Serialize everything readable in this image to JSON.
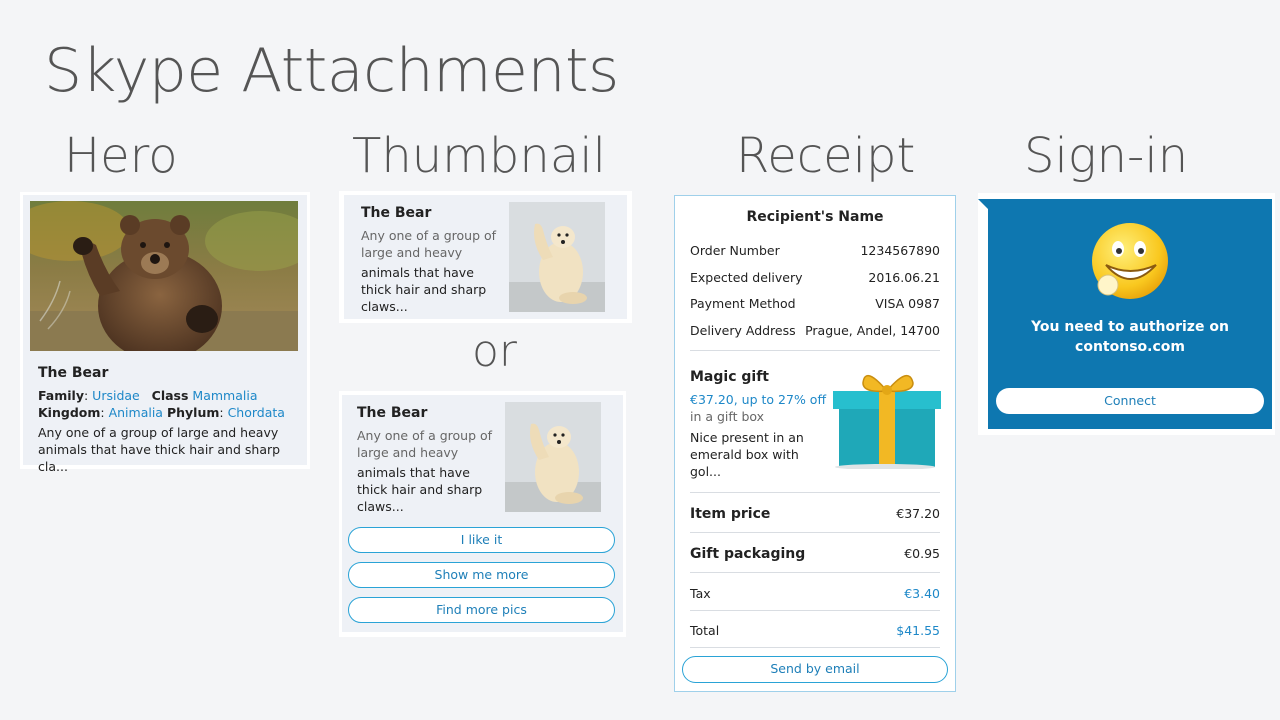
{
  "page": {
    "title": "Skype Attachments"
  },
  "sections": {
    "hero": "Hero",
    "thumbnail": "Thumbnail",
    "receipt": "Receipt",
    "signin": "Sign-in",
    "or": "or"
  },
  "hero_card": {
    "title": "The Bear",
    "family_label": "Family",
    "family_value": "Ursidae",
    "class_label": "Class",
    "class_value": "Mammalia",
    "kingdom_label": "Kingdom",
    "kingdom_value": "Animalia",
    "phylum_label": "Phylum",
    "phylum_value": "Chordata",
    "description": "Any one of a group of large and heavy animals that have thick hair and sharp cla..."
  },
  "thumbnail_card": {
    "title": "The Bear",
    "subtitle": "Any one of a group of large and heavy",
    "text": "animals that have thick hair and sharp claws..."
  },
  "thumbnail_card_buttons": {
    "title": "The Bear",
    "subtitle": "Any one of a group of large and heavy",
    "text": "animals that have thick hair and sharp claws...",
    "buttons": [
      "I  like it",
      "Show me more",
      "Find more pics"
    ]
  },
  "receipt": {
    "recipient": "Recipient's Name",
    "facts": [
      {
        "label": "Order Number",
        "value": "1234567890"
      },
      {
        "label": "Expected delivery",
        "value": "2016.06.21"
      },
      {
        "label": "Payment Method",
        "value": "VISA 0987"
      },
      {
        "label": "Delivery Address",
        "value": "Prague, Andel, 14700"
      }
    ],
    "item": {
      "title": "Magic gift",
      "price": "€37.20, up to 27% off",
      "subtitle": "in a gift box",
      "description": "Nice present in an emerald box with gol..."
    },
    "item_price_label": "Item price",
    "item_price_value": "€37.20",
    "gift_packaging_label": "Gift packaging",
    "gift_packaging_value": "€0.95",
    "tax_label": "Tax",
    "tax_value": "€3.40",
    "total_label": "Total",
    "total_value": "$41.55",
    "button": "Send by email"
  },
  "signin": {
    "line1": "You need to authorize on",
    "line2": "contonso.com",
    "button": "Connect"
  },
  "colors": {
    "accent": "#1e88c8",
    "signin_bg": "#0e77b0",
    "card_bg": "#eef1f6",
    "page_bg": "#f4f5f7"
  }
}
